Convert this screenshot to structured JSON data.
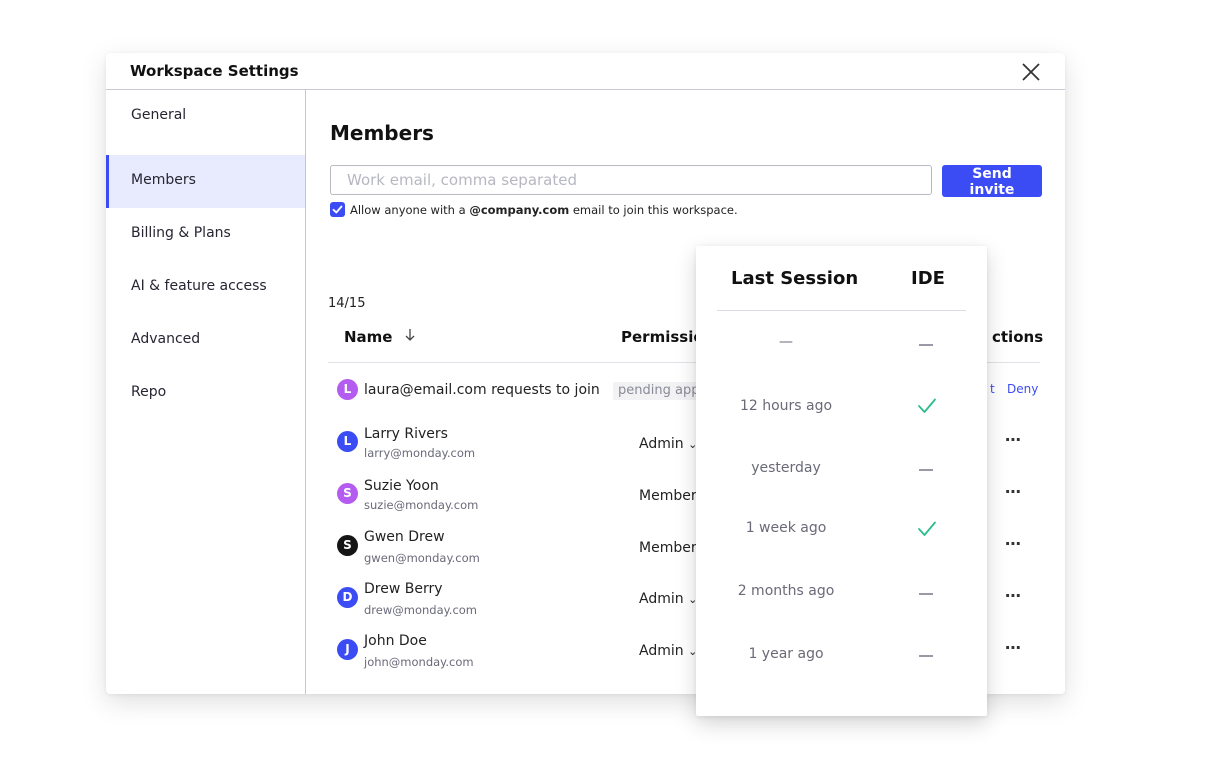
{
  "modal": {
    "title": "Workspace Settings"
  },
  "sidebar": {
    "items": [
      {
        "label": "General"
      },
      {
        "label": "Members",
        "active": true
      },
      {
        "label": "Billing & Plans"
      },
      {
        "label": "AI & feature access"
      },
      {
        "label": "Advanced"
      },
      {
        "label": "Repo"
      }
    ]
  },
  "members": {
    "title": "Members",
    "invite": {
      "placeholder": "Work email, comma separated",
      "button": "Send invite",
      "allow_prefix": "Allow anyone with a",
      "allow_domain": "@company.com",
      "allow_suffix": "email to join this workspace.",
      "allow_checked": true
    },
    "count": "14/15",
    "columns": {
      "name": "Name",
      "permission": "Permissio",
      "actions": "ctions"
    },
    "request": {
      "initial": "L",
      "text": "laura@email.com requests to join",
      "status": "pending app",
      "approve": "t",
      "deny": "Deny"
    },
    "rows": [
      {
        "initial": "L",
        "name": "Larry Rivers",
        "email": "larry@monday.com",
        "permission": "Admin",
        "avatar_color": "#3b4cf5"
      },
      {
        "initial": "S",
        "name": "Suzie Yoon",
        "email": "suzie@monday.com",
        "permission": "Member",
        "avatar_color": "#b45cf0"
      },
      {
        "initial": "S",
        "name": "Gwen Drew",
        "email": "gwen@monday.com",
        "permission": "Member",
        "avatar_color": "#151515"
      },
      {
        "initial": "D",
        "name": "Drew Berry",
        "email": "drew@monday.com",
        "permission": "Admin",
        "avatar_color": "#3b4cf5"
      },
      {
        "initial": "J",
        "name": "John Doe",
        "email": "john@monday.com",
        "permission": "Admin",
        "avatar_color": "#3b4cf5"
      }
    ]
  },
  "session_panel": {
    "headers": {
      "last_session": "Last Session",
      "ide": "IDE"
    },
    "rows": [
      {
        "last_session": "—",
        "ide": "dash"
      },
      {
        "last_session": "12 hours ago",
        "ide": "check"
      },
      {
        "last_session": "yesterday",
        "ide": "dash"
      },
      {
        "last_session": "1 week ago",
        "ide": "check"
      },
      {
        "last_session": "2 months ago",
        "ide": "dash"
      },
      {
        "last_session": "1 year ago",
        "ide": "dash"
      }
    ]
  },
  "colors": {
    "accent": "#3b4cf5",
    "active_bg": "#e8eafd",
    "request_avatar": "#b45cf0",
    "check": "#2bbd8c"
  }
}
